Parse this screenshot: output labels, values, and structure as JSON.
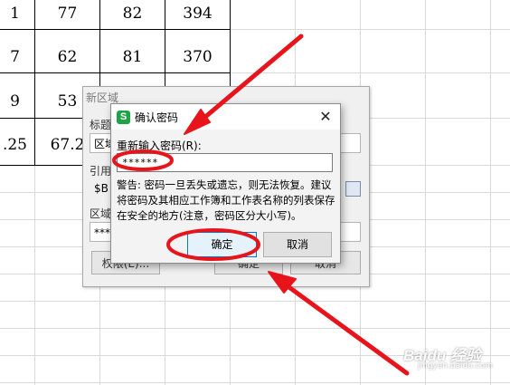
{
  "sheet": {
    "rows": [
      [
        "1",
        "77",
        "82",
        "394"
      ],
      [
        "7",
        "62",
        "81",
        "370"
      ],
      [
        "9",
        "53",
        "",
        ""
      ],
      [
        ".25",
        "67.2",
        "",
        ""
      ]
    ]
  },
  "new_area_dialog": {
    "title": "新区域",
    "title_label": "标题",
    "title_field": "区域",
    "ref_label": "引用",
    "ref_field": "$B",
    "pw_label": "区域",
    "pw_field": "****",
    "perm_button": "权限(E)...",
    "ok_button": "确定",
    "cancel_button": "取消"
  },
  "confirm_dialog": {
    "app_icon": "S",
    "title": "确认密码",
    "close_glyph": "✕",
    "reenter_label": "重新输入密码(R):",
    "password_value": "******",
    "warning": "警告: 密码一旦丢失或遗忘，则无法恢复。建议将密码及其相应工作簿和工作表名称的列表保存在安全的地方(注意，密码区分大小写)。",
    "ok_label": "确定",
    "cancel_label": "取消"
  },
  "annotation_color": "#e8141b",
  "watermark": {
    "brand": "Baidu 经验",
    "sub": "jingyan.baidu.com"
  }
}
